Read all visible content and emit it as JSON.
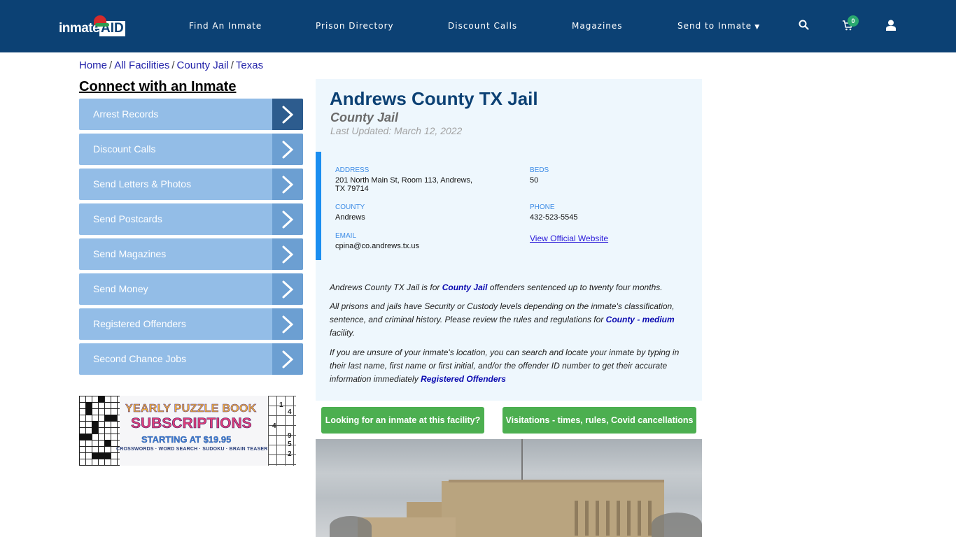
{
  "header": {
    "logo": {
      "text_left": "inmate",
      "text_right": "AID"
    },
    "nav": [
      {
        "label": "Find An Inmate"
      },
      {
        "label": "Prison Directory"
      },
      {
        "label": "Discount Calls"
      },
      {
        "label": "Magazines"
      },
      {
        "label": "Send to Inmate",
        "has_dropdown": true
      }
    ],
    "icons": {
      "search": "search-icon",
      "cart": "cart-icon",
      "user": "user-icon"
    },
    "cart_count": "0"
  },
  "breadcrumb": [
    "Home",
    "All Facilities",
    "County Jail",
    "Texas"
  ],
  "sidebar": {
    "title": "Connect with an Inmate",
    "items": [
      {
        "label": "Arrest Records",
        "active": true
      },
      {
        "label": "Discount Calls"
      },
      {
        "label": "Send Letters & Photos"
      },
      {
        "label": "Send Postcards"
      },
      {
        "label": "Send Magazines"
      },
      {
        "label": "Send Money"
      },
      {
        "label": "Registered Offenders"
      },
      {
        "label": "Second Chance Jobs"
      }
    ],
    "ad": {
      "line1": "YEARLY PUZZLE BOOK",
      "line2": "SUBSCRIPTIONS",
      "line3": "STARTING AT $19.95",
      "line4": "CROSSWORDS · WORD SEARCH · SUDOKU · BRAIN TEASERS",
      "sudoku_digits": [
        "1",
        "4",
        "4",
        "9",
        "5",
        "2"
      ]
    }
  },
  "facility": {
    "title": "Andrews County TX Jail",
    "type": "County Jail",
    "last_updated": "Last Updated: March 12, 2022",
    "info": {
      "address_label": "ADDRESS",
      "address_line1": "201 North Main St, Room 113, Andrews,",
      "address_line2": "TX 79714",
      "beds_label": "BEDS",
      "beds": "50",
      "county_label": "COUNTY",
      "county": "Andrews",
      "phone_label": "PHONE",
      "phone": "432-523-5545",
      "email_label": "EMAIL",
      "email": "cpina@co.andrews.tx.us",
      "website_link": "View Official Website"
    },
    "description": {
      "p1_pre": "Andrews County TX Jail is for ",
      "p1_link": "County Jail",
      "p1_post": " offenders sentenced up to twenty four months.",
      "p2_pre": "All prisons and jails have Security or Custody levels depending on the inmate's classification, sentence, and criminal history. Please review the rules and regulations for ",
      "p2_link": "County - medium",
      "p2_post": " facility.",
      "p3_pre": "If you are unsure of your inmate's location, you can search and locate your inmate by typing in their last name, first name or first initial, and/or the offender ID number to get their accurate information immediately ",
      "p3_link": "Registered Offenders"
    },
    "buttons": {
      "find_inmate": "Looking for an inmate at this facility?",
      "visitations": "Visitations - times, rules, Covid cancellations"
    }
  },
  "colors": {
    "navbar": "#0c4174",
    "sidebar_item": "#93bde7",
    "sidebar_arrow": "#6c9fd2",
    "sidebar_arrow_active": "#2d5c8e",
    "card_bg": "#eef7fd",
    "accent_bar": "#1b8ef0",
    "green_button": "#4caf50"
  }
}
